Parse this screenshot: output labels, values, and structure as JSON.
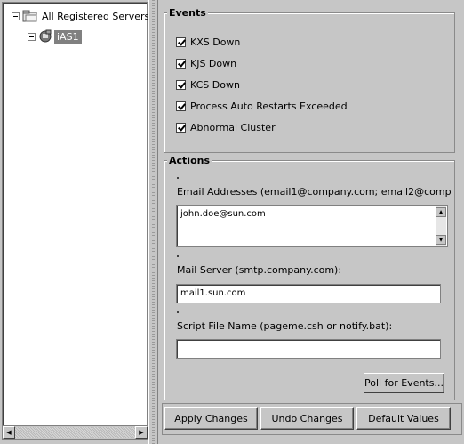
{
  "tree": {
    "root_label": "All Registered Servers",
    "child_label": "iAS1"
  },
  "events": {
    "title": "Events",
    "items": [
      {
        "label": "KXS Down",
        "checked": true
      },
      {
        "label": "KJS Down",
        "checked": true
      },
      {
        "label": "KCS Down",
        "checked": true
      },
      {
        "label": "Process Auto Restarts Exceeded",
        "checked": true
      },
      {
        "label": "Abnormal Cluster",
        "checked": true
      }
    ]
  },
  "actions": {
    "title": "Actions",
    "email_label": "Email Addresses (email1@company.com; email2@company.com",
    "email_value": "john.doe@sun.com",
    "mail_server_label": "Mail Server (smtp.company.com):",
    "mail_server_value": "mail1.sun.com",
    "script_label": "Script File Name (pageme.csh or notify.bat):",
    "script_value": "",
    "poll_button": "Poll for Events..."
  },
  "buttons": {
    "apply": "Apply Changes",
    "undo": "Undo Changes",
    "defaults": "Default Values"
  }
}
